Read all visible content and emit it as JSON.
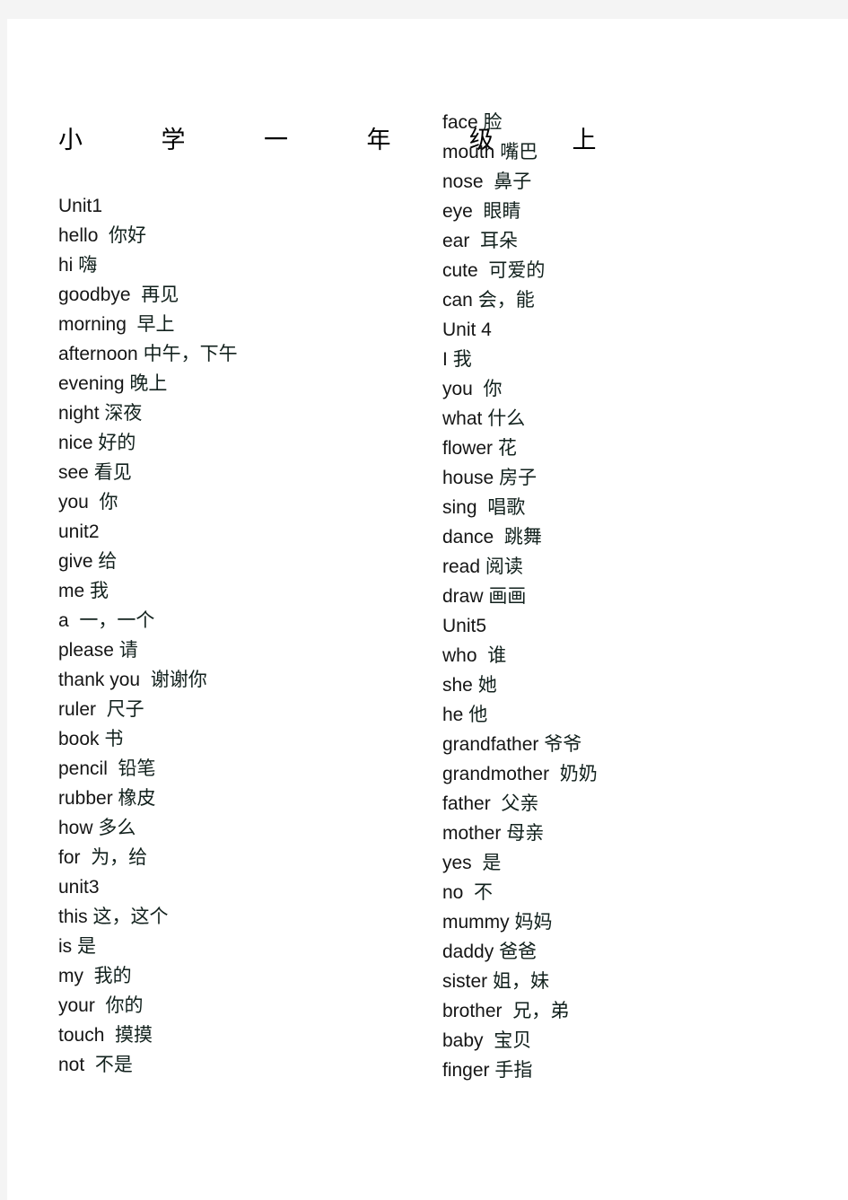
{
  "document": {
    "title": "小   学   一   年   级   上",
    "title_chars": [
      "小",
      "学",
      "一",
      "年",
      "级",
      "上"
    ],
    "page_background": "#ffffff",
    "canvas_background": "#f4f4f4",
    "text_color": "#151515"
  },
  "columns": [
    {
      "name": "left-column",
      "lines": [
        {
          "en": "Unit1",
          "zh": ""
        },
        {
          "en": "hello",
          "gap": "  ",
          "zh": "你好"
        },
        {
          "en": "hi",
          "gap": " ",
          "zh": "嗨"
        },
        {
          "en": "goodbye",
          "gap": "  ",
          "zh": "再见"
        },
        {
          "en": "morning",
          "gap": "  ",
          "zh": "早上"
        },
        {
          "en": "afternoon",
          "gap": " ",
          "zh": "中午，下午"
        },
        {
          "en": "evening",
          "gap": " ",
          "zh": "晚上"
        },
        {
          "en": "night",
          "gap": " ",
          "zh": "深夜"
        },
        {
          "en": "nice",
          "gap": " ",
          "zh": "好的"
        },
        {
          "en": "see",
          "gap": " ",
          "zh": "看见"
        },
        {
          "en": "you",
          "gap": "  ",
          "zh": "你"
        },
        {
          "en": "unit2",
          "zh": ""
        },
        {
          "en": "give",
          "gap": " ",
          "zh": "给"
        },
        {
          "en": "me",
          "gap": " ",
          "zh": "我"
        },
        {
          "en": "a",
          "gap": "  ",
          "zh": "一，一个"
        },
        {
          "en": "please",
          "gap": " ",
          "zh": "请"
        },
        {
          "en": "thank you",
          "gap": "  ",
          "zh": "谢谢你"
        },
        {
          "en": "ruler",
          "gap": "  ",
          "zh": "尺子"
        },
        {
          "en": "book",
          "gap": " ",
          "zh": "书"
        },
        {
          "en": "pencil",
          "gap": "  ",
          "zh": "铅笔"
        },
        {
          "en": "rubber",
          "gap": " ",
          "zh": "橡皮"
        },
        {
          "en": "how",
          "gap": " ",
          "zh": "多么"
        },
        {
          "en": "for",
          "gap": "  ",
          "zh": "为，给"
        },
        {
          "en": "unit3",
          "zh": ""
        },
        {
          "en": "this",
          "gap": " ",
          "zh": "这，这个"
        },
        {
          "en": "is",
          "gap": " ",
          "zh": "是"
        },
        {
          "en": "my",
          "gap": "  ",
          "zh": "我的"
        },
        {
          "en": "your",
          "gap": "  ",
          "zh": "你的"
        },
        {
          "en": "touch",
          "gap": "  ",
          "zh": "摸摸"
        },
        {
          "en": "not",
          "gap": "  ",
          "zh": "不是"
        }
      ]
    },
    {
      "name": "right-column",
      "lines": [
        {
          "en": "face",
          "gap": " ",
          "zh": "脸"
        },
        {
          "en": "mouth",
          "gap": " ",
          "zh": "嘴巴"
        },
        {
          "en": "nose",
          "gap": "  ",
          "zh": "鼻子"
        },
        {
          "en": "eye",
          "gap": "  ",
          "zh": "眼睛"
        },
        {
          "en": "ear",
          "gap": "  ",
          "zh": "耳朵"
        },
        {
          "en": "cute",
          "gap": "  ",
          "zh": "可爱的"
        },
        {
          "en": "can",
          "gap": " ",
          "zh": "会，能"
        },
        {
          "en": "Unit 4",
          "zh": ""
        },
        {
          "en": "I",
          "gap": " ",
          "zh": "我"
        },
        {
          "en": "you",
          "gap": "  ",
          "zh": "你"
        },
        {
          "en": "what",
          "gap": " ",
          "zh": "什么"
        },
        {
          "en": "flower",
          "gap": " ",
          "zh": "花"
        },
        {
          "en": "house",
          "gap": " ",
          "zh": "房子"
        },
        {
          "en": "sing",
          "gap": "  ",
          "zh": "唱歌"
        },
        {
          "en": "dance",
          "gap": "  ",
          "zh": "跳舞"
        },
        {
          "en": "read",
          "gap": " ",
          "zh": "阅读"
        },
        {
          "en": "draw",
          "gap": " ",
          "zh": "画画"
        },
        {
          "en": "Unit5",
          "zh": ""
        },
        {
          "en": "who",
          "gap": "  ",
          "zh": "谁"
        },
        {
          "en": "she",
          "gap": " ",
          "zh": "她"
        },
        {
          "en": "he",
          "gap": " ",
          "zh": "他"
        },
        {
          "en": "grandfather",
          "gap": " ",
          "zh": "爷爷"
        },
        {
          "en": "grandmother",
          "gap": "  ",
          "zh": "奶奶"
        },
        {
          "en": "father",
          "gap": "  ",
          "zh": "父亲"
        },
        {
          "en": "mother",
          "gap": " ",
          "zh": "母亲"
        },
        {
          "en": "yes",
          "gap": "  ",
          "zh": "是"
        },
        {
          "en": "no",
          "gap": "  ",
          "zh": "不"
        },
        {
          "en": "mummy",
          "gap": " ",
          "zh": "妈妈"
        },
        {
          "en": "daddy",
          "gap": " ",
          "zh": "爸爸"
        },
        {
          "en": "sister",
          "gap": " ",
          "zh": "姐，妹"
        },
        {
          "en": "brother",
          "gap": "  ",
          "zh": "兄，弟"
        },
        {
          "en": "baby",
          "gap": "  ",
          "zh": "宝贝"
        },
        {
          "en": "finger",
          "gap": " ",
          "zh": "手指"
        }
      ]
    }
  ]
}
